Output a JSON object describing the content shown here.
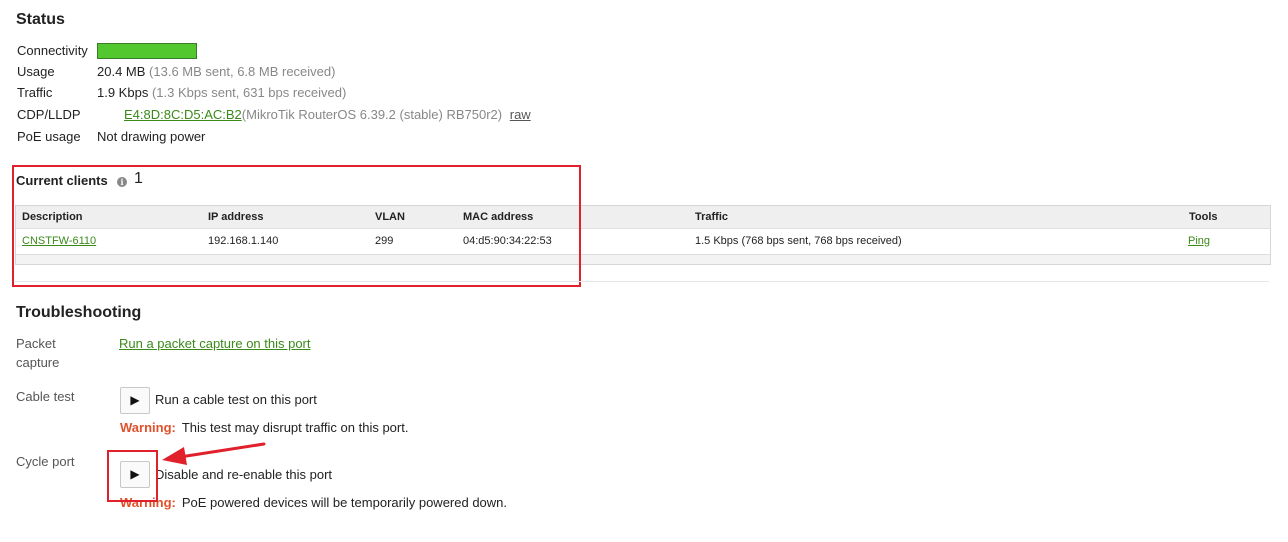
{
  "status": {
    "title": "Status",
    "connectivity_label": "Connectivity",
    "connectivity_color": "#52c72e",
    "usage_label": "Usage",
    "usage_value": "20.4 MB",
    "usage_detail": "(13.6 MB sent, 6.8 MB received)",
    "traffic_label": "Traffic",
    "traffic_value": "1.9 Kbps",
    "traffic_detail": "(1.3 Kbps sent, 631 bps received)",
    "cdp_label": "CDP/LLDP",
    "cdp_mac": "E4:8D:8C:D5:AC:B2",
    "cdp_detail": "(MikroTik RouterOS 6.39.2 (stable) RB750r2)",
    "cdp_raw": "raw",
    "poe_label": "PoE usage",
    "poe_value": "Not drawing power"
  },
  "clients": {
    "title": "Current clients",
    "info_icon": "info-icon",
    "count": "1",
    "headers": {
      "description": "Description",
      "ip": "IP address",
      "vlan": "VLAN",
      "mac": "MAC address",
      "traffic": "Traffic",
      "tools": "Tools"
    },
    "rows": [
      {
        "description": "CNSTFW-6110",
        "ip": "192.168.1.140",
        "vlan": "299",
        "mac": "04:d5:90:34:22:53",
        "traffic": "1.5 Kbps (768 bps sent, 768 bps received)",
        "tools": "Ping"
      }
    ]
  },
  "troubleshooting": {
    "title": "Troubleshooting",
    "packet_label_line1": "Packet",
    "packet_label_line2": "capture",
    "packet_link": "Run a packet capture on this port",
    "cable_label": "Cable test",
    "cable_button": "▶",
    "cable_text": "Run a cable test on this port",
    "cable_warning_label": "Warning:",
    "cable_warning_text": "This test may disrupt traffic on this port.",
    "cycle_label": "Cycle port",
    "cycle_button": "▶",
    "cycle_text": "Disable and re-enable this port",
    "cycle_warning_label": "Warning:",
    "cycle_warning_text": "PoE powered devices will be temporarily powered down."
  },
  "annotations": {
    "highlight_color": "#e0202a"
  }
}
